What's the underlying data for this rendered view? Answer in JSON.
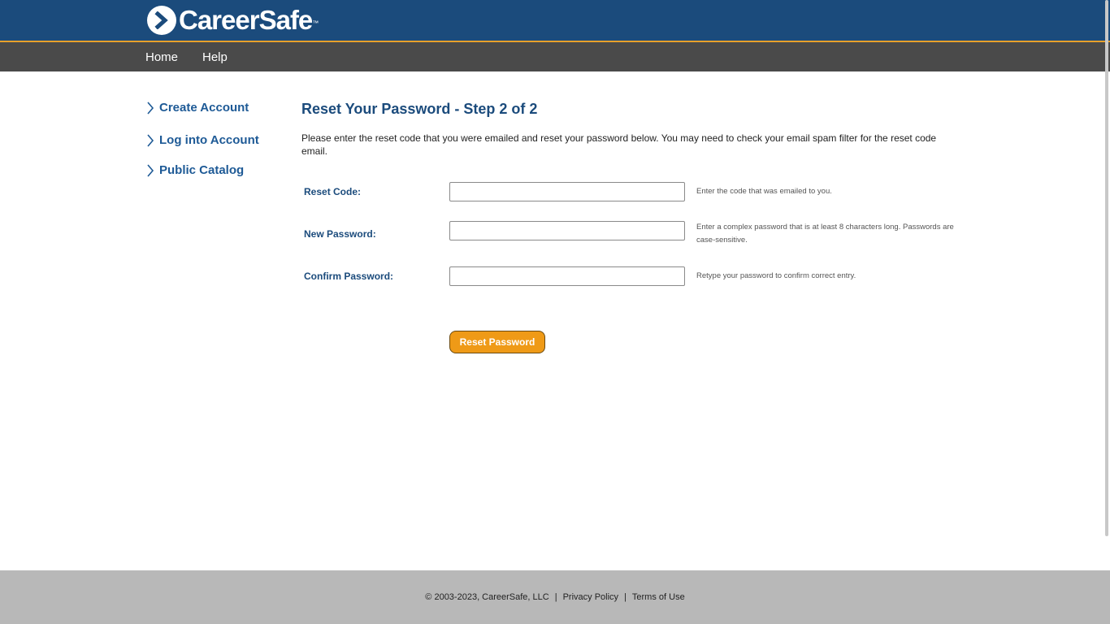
{
  "brand": {
    "name": "CareerSafe",
    "trademark": "™",
    "header_color": "#1b4b7c",
    "accent_color": "#e8a02a"
  },
  "nav": {
    "home_label": "Home",
    "help_label": "Help"
  },
  "sidebar": {
    "items": [
      {
        "label": "Create Account",
        "icon": "chevron-right-icon"
      },
      {
        "label": "Log into Account",
        "icon": "chevron-right-icon"
      },
      {
        "label": "Public Catalog",
        "icon": "chevron-right-icon"
      }
    ]
  },
  "main": {
    "title": "Reset Your Password - Step 2 of 2",
    "intro": "Please enter the reset code that you were emailed and reset your password below. You may need to check your email spam filter for the reset code email.",
    "fields": [
      {
        "label": "Reset Code:",
        "value": "",
        "hint": "Enter the code that was emailed to you."
      },
      {
        "label": "New Password:",
        "value": "",
        "hint": "Enter a complex password that is at least 8 characters long. Passwords are case-sensitive."
      },
      {
        "label": "Confirm Password:",
        "value": "",
        "hint": "Retype your password to confirm correct entry."
      }
    ],
    "submit_label": "Reset Password",
    "button_color": "#ef9a17"
  },
  "footer": {
    "copyright": "© 2003-2023, CareerSafe, LLC",
    "separator": "|",
    "privacy_label": "Privacy Policy",
    "terms_label": "Terms of Use"
  }
}
